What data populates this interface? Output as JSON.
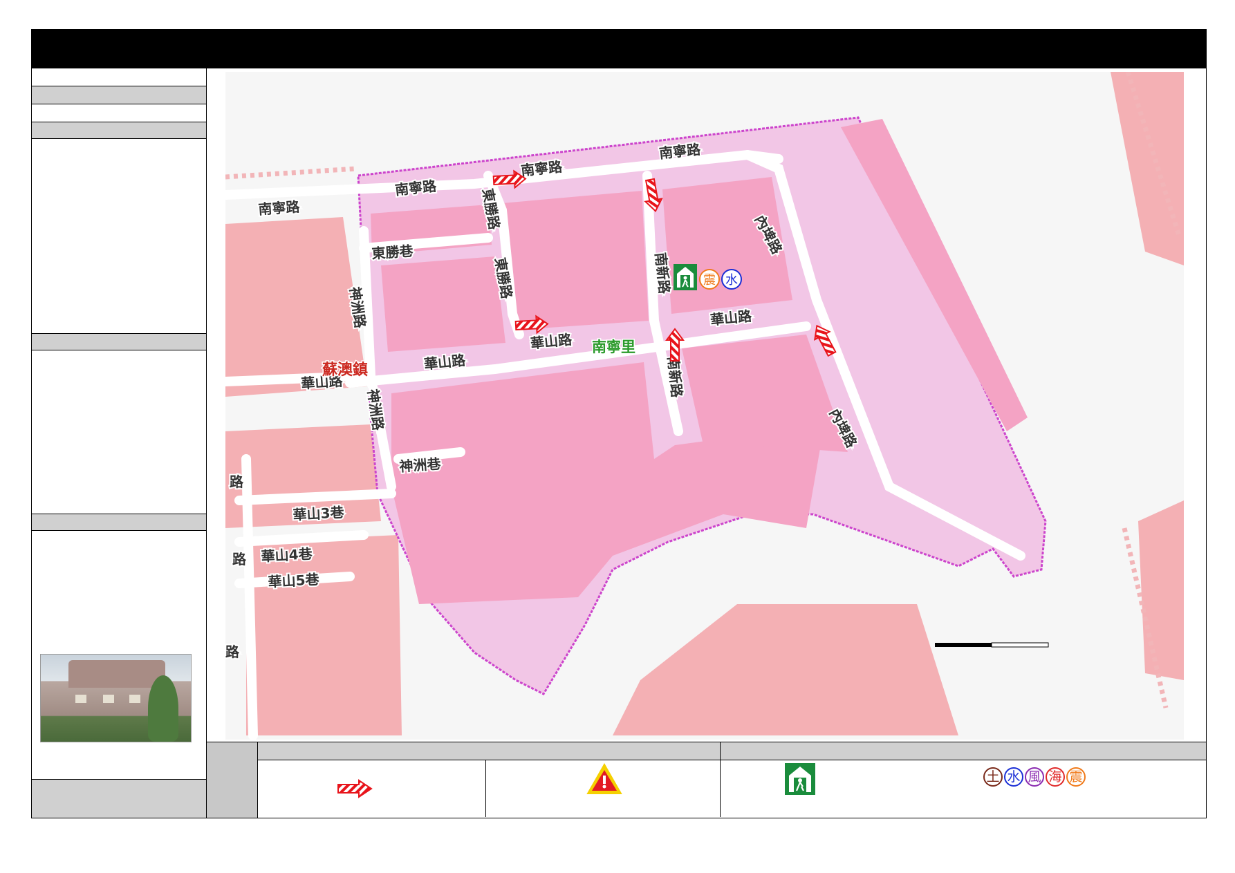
{
  "map": {
    "district_label": "蘇澳鎮",
    "village_label": "南寧里",
    "roads": [
      "南寧路",
      "南寧路",
      "南寧路",
      "南寧路",
      "東勝路",
      "東勝路",
      "東勝巷",
      "內埤路",
      "內埤路",
      "南新路",
      "南新路",
      "華山路",
      "華山路",
      "華山路",
      "華山路",
      "神洲路",
      "神洲路",
      "神洲巷",
      "華山3巷",
      "華山4巷",
      "華山5巷",
      "路",
      "路",
      "路"
    ],
    "shelter_hazards": [
      "震",
      "水"
    ]
  },
  "legend": {
    "hazard_badges": [
      "土",
      "水",
      "風",
      "海",
      "震"
    ]
  },
  "colors": {
    "village_boundary": "#cc44cc",
    "village_fill": "#f2c6e6",
    "building_fill": "#f4a3ad",
    "road_fill": "#ffffff",
    "evac_arrow": "#e8141b",
    "shelter_green": "#1a8c3c",
    "hazard_earthquake": "#f07a1a",
    "hazard_water": "#1a2ed6",
    "hazard_soil": "#7a2a1a",
    "hazard_wind": "#8a2ab0",
    "hazard_sea": "#e02a2a",
    "warning_yellow": "#f5d000",
    "warning_red": "#e31b23"
  },
  "icons": {
    "evacuation_direction": "hatched-arrow-icon",
    "danger_point": "warning-triangle-icon",
    "shelter": "shelter-icon"
  }
}
